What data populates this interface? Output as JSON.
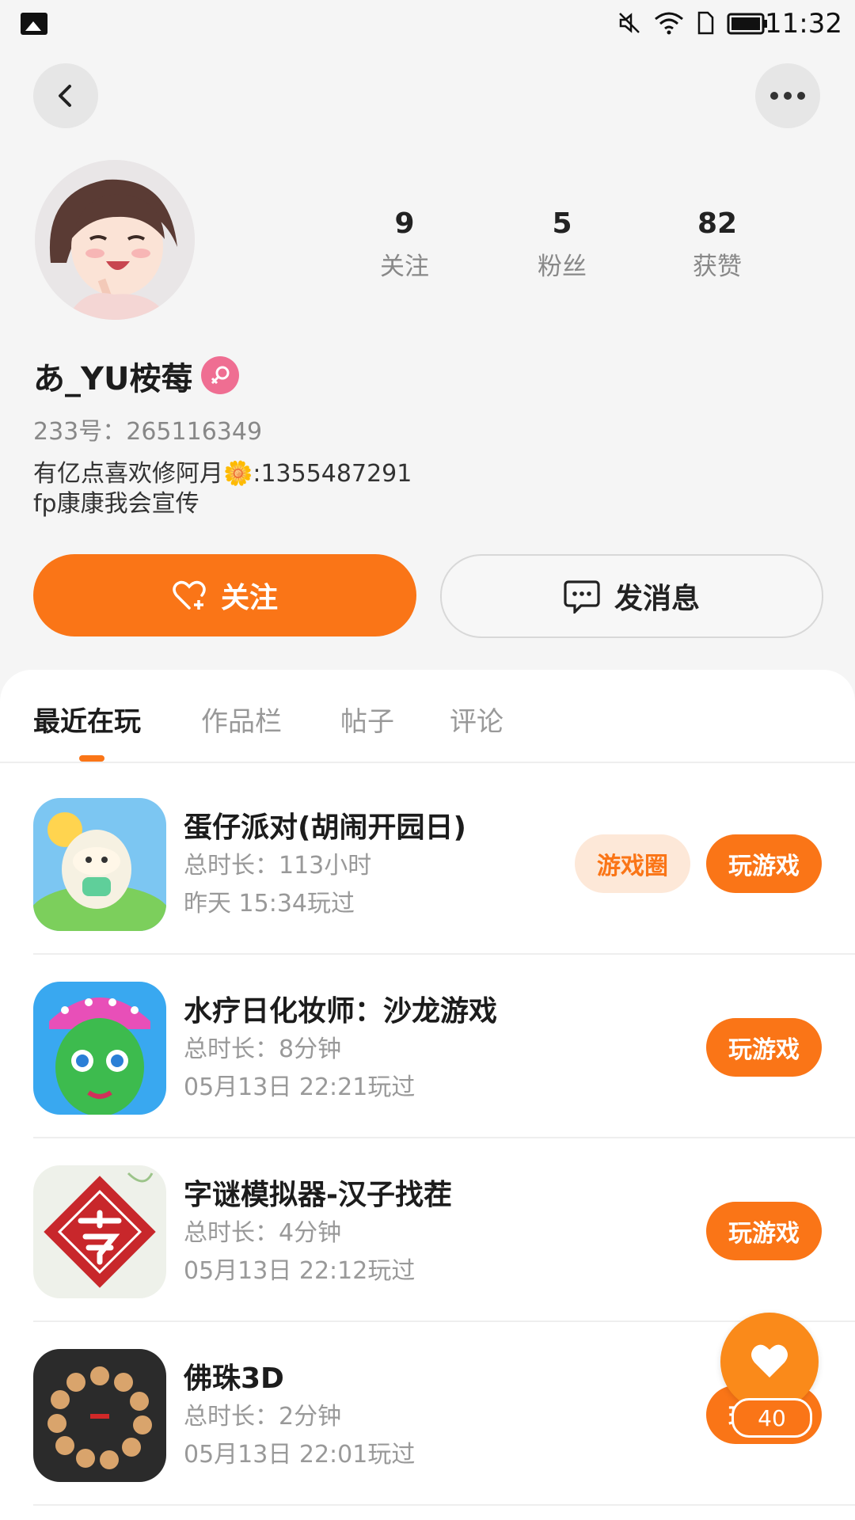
{
  "status_bar": {
    "time": "11:32",
    "icons": [
      "gallery-icon",
      "mute-icon",
      "wifi-icon",
      "sim-icon",
      "battery-icon"
    ]
  },
  "header": {
    "back_icon": "back-icon",
    "more_icon": "more-icon"
  },
  "profile": {
    "stats": [
      {
        "num": "9",
        "label": "关注"
      },
      {
        "num": "5",
        "label": "粉丝"
      },
      {
        "num": "82",
        "label": "获赞"
      }
    ],
    "username": "あ_YU桉莓",
    "gender": "female",
    "uid": "233号：265116349",
    "bio_line1": "有亿点喜欢修阿月🌼:1355487291",
    "bio_line2": "fp康康我会宣传"
  },
  "actions": {
    "follow": "关注",
    "message": "发消息"
  },
  "tabs": [
    {
      "label": "最近在玩",
      "active": true
    },
    {
      "label": "作品栏",
      "active": false
    },
    {
      "label": "帖子",
      "active": false
    },
    {
      "label": "评论",
      "active": false
    }
  ],
  "games": [
    {
      "title": "蛋仔派对(胡闹开园日)",
      "duration": "总时长：113小时",
      "last_played": "昨天 15:34玩过",
      "circle_label": "游戏圈",
      "play_label": "玩游戏"
    },
    {
      "title": "水疗日化妆师：沙龙游戏",
      "duration": "总时长：8分钟",
      "last_played": "05月13日 22:21玩过",
      "play_label": "玩游戏"
    },
    {
      "title": "字谜模拟器-汉子找茬",
      "duration": "总时长：4分钟",
      "last_played": "05月13日 22:12玩过",
      "play_label": "玩游戏"
    },
    {
      "title": "佛珠3D",
      "duration": "总时长：2分钟",
      "last_played": "05月13日 22:01玩过",
      "play_label": "玩游戏"
    }
  ],
  "like_fab": {
    "count": "40"
  },
  "colors": {
    "accent": "#fa7517",
    "gender_badge": "#ef6e92",
    "circle_bg": "#fde8d8"
  }
}
